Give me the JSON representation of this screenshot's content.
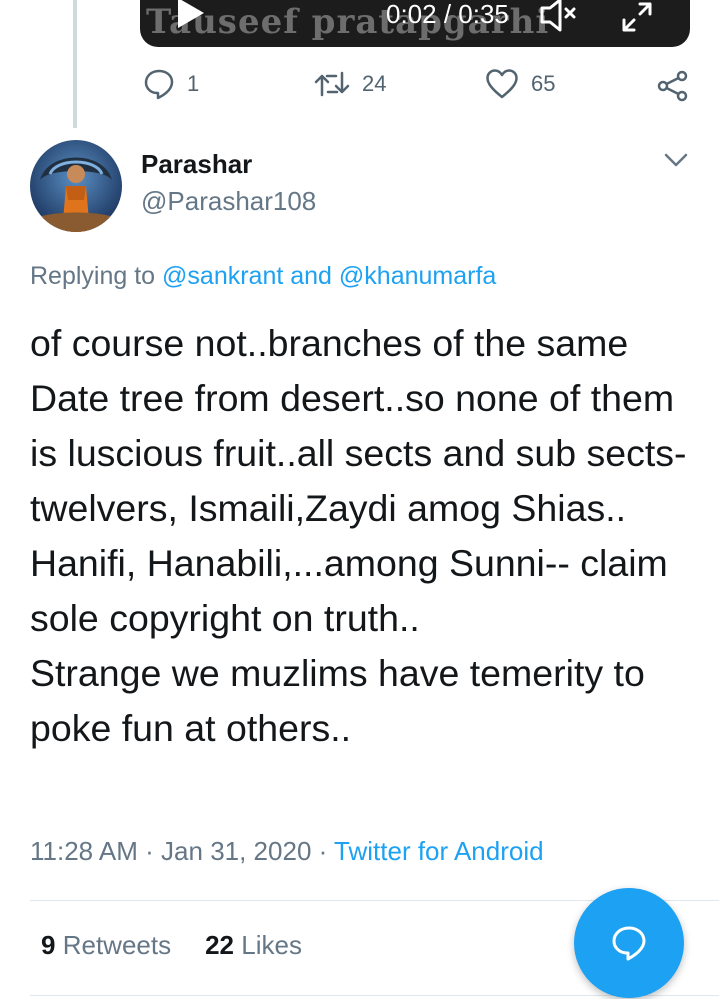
{
  "previous_tweet": {
    "video": {
      "watermark": "Tauseef pratapgarhi",
      "time": "0:02 / 0:35"
    },
    "actions": {
      "reply_count": "1",
      "retweet_count": "24",
      "like_count": "65"
    }
  },
  "tweet": {
    "display_name": "Parashar",
    "handle": "@Parashar108",
    "replying_prefix": "Replying to ",
    "reply_mention_1": "@sankrant",
    "reply_and": " and ",
    "reply_mention_2": "@khanumarfa",
    "text": "of course not..branches of the same Date tree from desert..so none of them is luscious fruit..all sects and sub sects- twelvers, Ismaili,Zaydi amog Shias.. Hanifi, Hanabili,...among Sunni-- claim sole copyright on truth..\nStrange we muzlims have temerity to poke fun at others..",
    "time": "11:28 AM",
    "separator": " · ",
    "date": "Jan 31, 2020",
    "source": "Twitter for Android",
    "retweets_count": "9",
    "retweets_label": "Retweets",
    "likes_count": "22",
    "likes_label": "Likes"
  },
  "colors": {
    "accent": "#1da1f2",
    "secondary_text": "#657786",
    "primary_text": "#14171a"
  },
  "icons": [
    "play-icon",
    "mute-icon",
    "fullscreen-icon",
    "reply-icon",
    "retweet-icon",
    "like-icon",
    "share-icon",
    "caret-down-icon",
    "compose-reply-icon"
  ]
}
